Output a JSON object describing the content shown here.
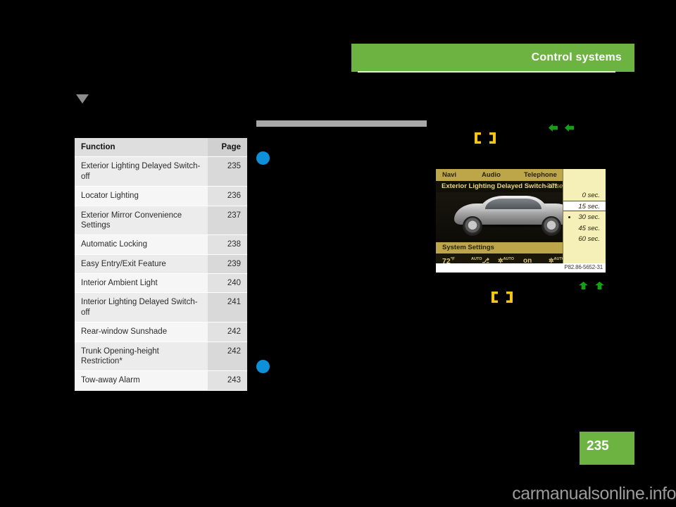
{
  "header": {
    "title": "Control systems",
    "accent_color": "#6CB342"
  },
  "page": {
    "number": "235",
    "watermark": "carmanualsonline.info"
  },
  "table": {
    "columns": [
      "Function",
      "Page"
    ],
    "rows": [
      {
        "function": "Exterior Lighting Delayed Switch-off",
        "page": "235"
      },
      {
        "function": "Locator Lighting",
        "page": "236"
      },
      {
        "function": "Exterior Mirror Convenience Settings",
        "page": "237"
      },
      {
        "function": "Automatic Locking",
        "page": "238"
      },
      {
        "function": "Easy Entry/Exit Feature",
        "page": "239"
      },
      {
        "function": "Interior Ambient Light",
        "page": "240"
      },
      {
        "function": "Interior Lighting Delayed Switch-off",
        "page": "241"
      },
      {
        "function": "Rear-window Sunshade",
        "page": "242"
      },
      {
        "function": "Trunk Opening-height Restriction*",
        "page": "242"
      },
      {
        "function": "Tow-away Alarm",
        "page": "243"
      }
    ]
  },
  "nav_display": {
    "menu": [
      "Navi",
      "Audio",
      "Telephone"
    ],
    "title": "Exterior Lighting Delayed Switch-off",
    "title_value": "30 sec.",
    "system_settings_label": "System Settings",
    "climate": {
      "temperature": "72",
      "temperature_unit": "°F",
      "seat_auto": "AUTO",
      "fan_auto_left": "AUTO",
      "center_state": "on",
      "fan_auto_right": "AUTO",
      "edge_auto": "AUTO"
    },
    "dropdown": {
      "options": [
        "0 sec.",
        "15 sec.",
        "30 sec.",
        "45 sec.",
        "60 sec."
      ],
      "highlighted": "15 sec.",
      "current": "30 sec."
    },
    "caption_code": "P82.86-5652-31"
  }
}
